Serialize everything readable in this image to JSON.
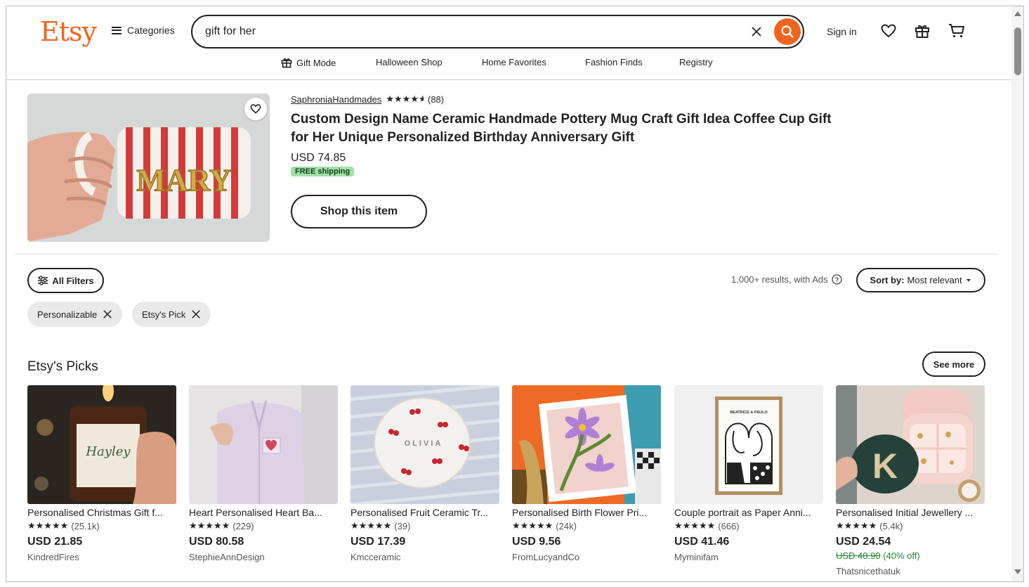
{
  "header": {
    "logo": "Etsy",
    "categories_label": "Categories",
    "search_value": "gift for her",
    "sign_in": "Sign in"
  },
  "nav": {
    "items": [
      "Gift Mode",
      "Halloween Shop",
      "Home Favorites",
      "Fashion Finds",
      "Registry"
    ]
  },
  "ad": {
    "shop": "SaphroniaHandmades",
    "rating": 4.5,
    "reviews": "(88)",
    "title": "Custom Design Name Ceramic Handmade Pottery Mug Craft Gift Idea Coffee Cup Gift for Her Unique Personalized Birthday Anniversary Gift",
    "price": "USD 74.85",
    "shipping": "FREE shipping",
    "button": "Shop this item",
    "image_text": "MARY"
  },
  "filters": {
    "all_filters": "All Filters",
    "results": "1,000+ results, with Ads",
    "sort_prefix": "Sort by:",
    "sort_value": "Most relevant",
    "chips": [
      "Personalizable",
      "Etsy's Pick"
    ]
  },
  "picks": {
    "title": "Etsy's Picks",
    "see_more": "See more",
    "items": [
      {
        "title": "Personalised Christmas Gift f...",
        "stars": "★★★★★",
        "reviews": "(25.1k)",
        "price": "USD 21.85",
        "shop": "KindredFires",
        "image_text": "Hayley"
      },
      {
        "title": "Heart Personalised Heart Ba...",
        "stars": "★★★★★",
        "reviews": "(229)",
        "price": "USD 80.58",
        "shop": "StephieAnnDesign",
        "image_text": ""
      },
      {
        "title": "Personalised Fruit Ceramic Tr...",
        "stars": "★★★★★",
        "reviews": "(39)",
        "price": "USD 17.39",
        "shop": "Kmcceramic",
        "image_text": "OLIVIA"
      },
      {
        "title": "Personalised Birth Flower Pri...",
        "stars": "★★★★★",
        "reviews": "(24k)",
        "price": "USD 9.56",
        "shop": "FromLucyandCo",
        "image_text": ""
      },
      {
        "title": "Couple portrait as Paper Anni...",
        "stars": "★★★★★",
        "reviews": "(666)",
        "price": "USD 41.46",
        "shop": "Myminifam",
        "image_text": "BEATRICE & PAULO"
      },
      {
        "title": "Personalised Initial Jewellery ...",
        "stars": "★★★★★",
        "reviews": "(5.4k)",
        "price": "USD 24.54",
        "original_price": "USD 40.90",
        "discount": "(40% off)",
        "shop": "Thatsnicethatuk",
        "image_text": "K"
      }
    ]
  },
  "colors": {
    "brand_orange": "#F1641E",
    "free_shipping_bg": "#9ee1a6",
    "sale_green": "#258635"
  }
}
